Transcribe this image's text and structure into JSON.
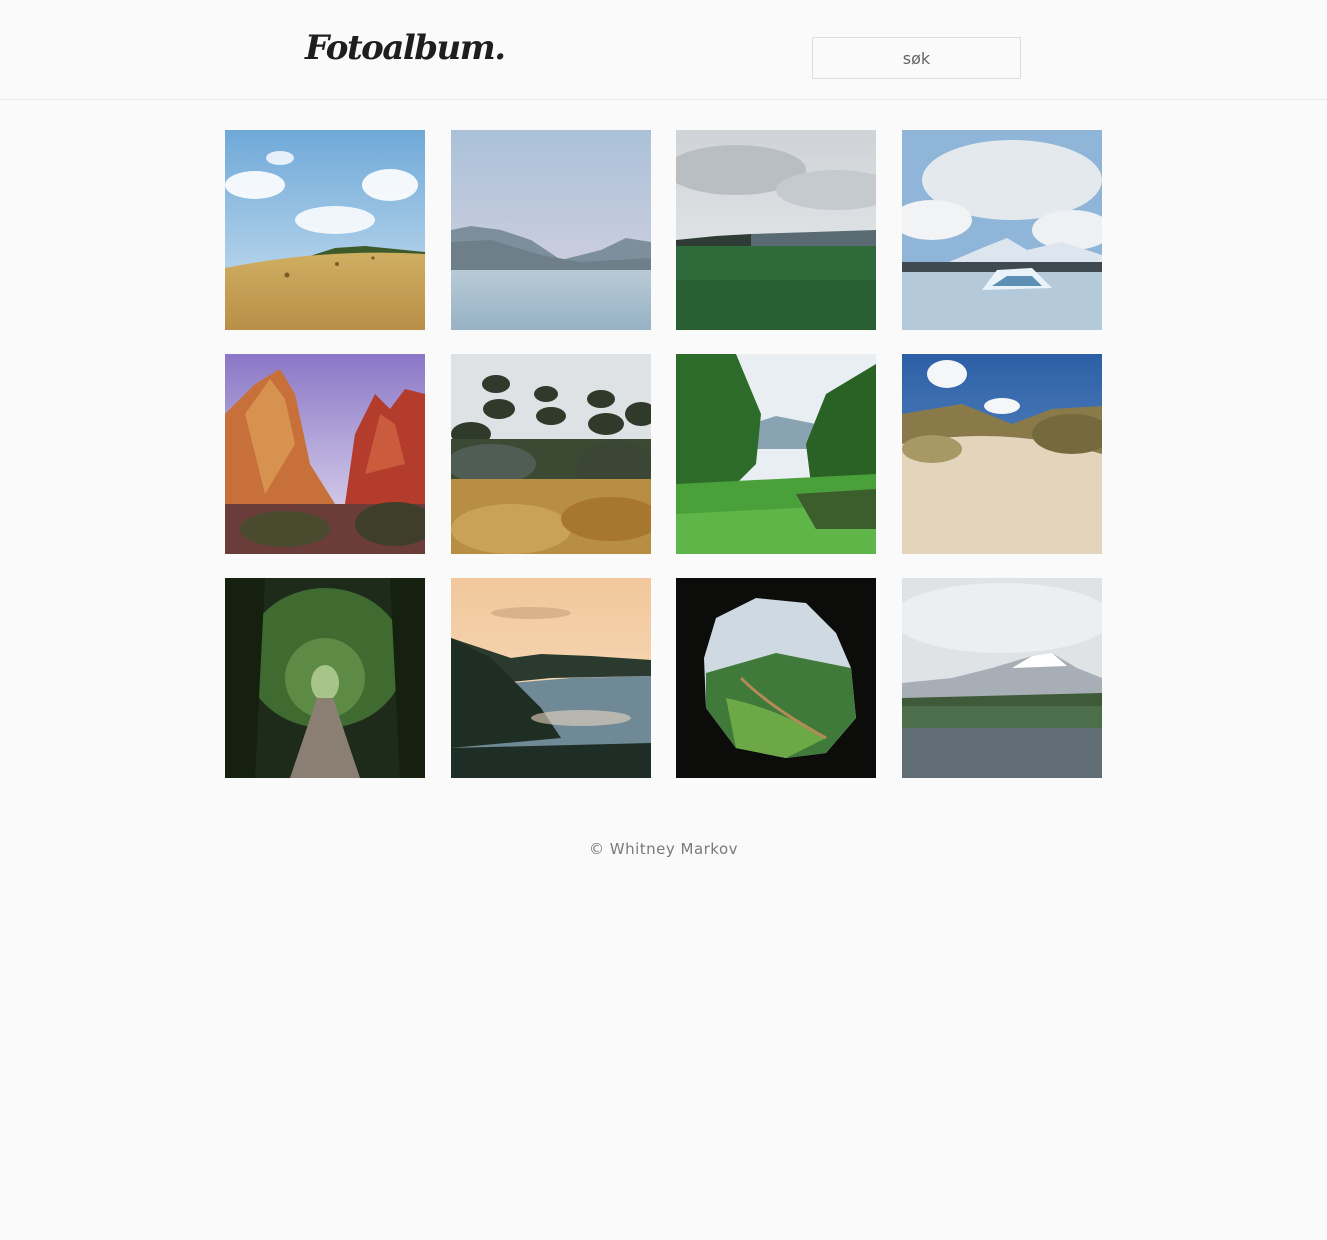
{
  "header": {
    "logo": "Fotoalbum.",
    "search_placeholder": "søk"
  },
  "gallery": {
    "photos": [
      {
        "subject": "golden hayfield under blue sky",
        "icon": "photo-icon"
      },
      {
        "subject": "misty lake with mountains",
        "icon": "photo-icon"
      },
      {
        "subject": "green field under grey clouds",
        "icon": "photo-icon"
      },
      {
        "subject": "glacier lagoon with icebergs",
        "icon": "photo-icon"
      },
      {
        "subject": "red rock canyon cliffs",
        "icon": "photo-icon"
      },
      {
        "subject": "garden of pine trees and shrubs",
        "icon": "photo-icon"
      },
      {
        "subject": "green valley framed by trees",
        "icon": "photo-icon"
      },
      {
        "subject": "sand dunes with dune grass",
        "icon": "photo-icon"
      },
      {
        "subject": "tree tunnel path",
        "icon": "photo-icon"
      },
      {
        "subject": "coastline at sunset",
        "icon": "photo-icon"
      },
      {
        "subject": "cave opening overlooking valley",
        "icon": "photo-icon"
      },
      {
        "subject": "snowy mountain over lupine meadow",
        "icon": "photo-icon"
      }
    ]
  },
  "footer": {
    "copyright": "© Whitney Markov"
  }
}
